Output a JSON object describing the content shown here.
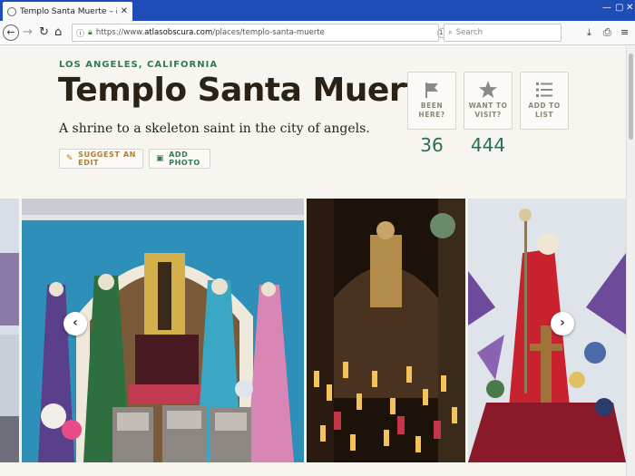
{
  "browser": {
    "tab_title": "Templo Santa Muerte – Los Angeles",
    "url_prefix": "https://www.",
    "url_domain": "atlasobscura.com",
    "url_path": "/places/templo-santa-muerte",
    "zoom": "110%",
    "search_placeholder": "Search",
    "icons": [
      "globe-icon",
      "close-icon",
      "new-tab-icon",
      "back-icon",
      "forward-icon",
      "reload-icon",
      "home-icon",
      "info-icon",
      "lock-icon",
      "more-icon",
      "pocket-icon",
      "star-icon",
      "search-icon",
      "download-icon",
      "print-icon",
      "menu-icon"
    ]
  },
  "place": {
    "location": "LOS ANGELES, CALIFORNIA",
    "title": "Templo Santa Muerte",
    "subtitle": "A shrine to a skeleton saint in the city of angels."
  },
  "actions": {
    "suggest_edit": "SUGGEST AN EDIT",
    "add_photo": "ADD PHOTO"
  },
  "stats": [
    {
      "label_1": "BEEN",
      "label_2": "HERE?",
      "count": "36",
      "icon": "flag-icon"
    },
    {
      "label_1": "WANT TO",
      "label_2": "VISIT?",
      "count": "444",
      "icon": "star-icon"
    },
    {
      "label_1": "ADD TO",
      "label_2": "LIST",
      "count": "",
      "icon": "list-icon"
    }
  ],
  "colors": {
    "tab_bar": "#1f4db8",
    "accent_green": "#2f7a55",
    "accent_orange": "#b47b2d",
    "title_text": "#2a2216"
  }
}
